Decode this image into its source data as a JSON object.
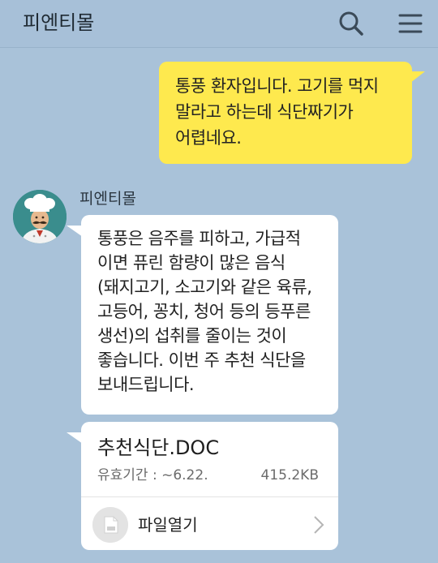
{
  "header": {
    "title": "피엔티몰",
    "search_icon": "search-icon",
    "menu_icon": "hamburger-menu-icon"
  },
  "messages": [
    {
      "direction": "outgoing",
      "lines": [
        "통풍 환자입니다. 고기를 먹지",
        "말라고 하는데 식단짜기가",
        "어렵네요."
      ]
    },
    {
      "direction": "incoming",
      "sender": "피엔티몰",
      "avatar_icon": "chef-avatar-icon",
      "lines": [
        "통풍은 음주를 피하고, 가급적",
        "이면 퓨린 함량이 많은 음식",
        "(돼지고기, 소고기와 같은 육류,",
        "고등어, 꽁치, 청어 등의 등푸른",
        "생선)의 섭취를 줄이는 것이",
        "좋습니다. 이번 주 추천 식단을",
        "보내드립니다."
      ]
    }
  ],
  "file": {
    "name": "추천식단.DOC",
    "expiry": "유효기간 : ~6.22.",
    "size": "415.2KB",
    "open_label": "파일열기",
    "doc_icon": "document-icon",
    "chevron_icon": "chevron-right-icon"
  },
  "colors": {
    "background": "#a9c2d9",
    "outgoing_bubble": "#fee94e",
    "incoming_bubble": "#ffffff",
    "avatar_bg": "#3a8d8d"
  }
}
